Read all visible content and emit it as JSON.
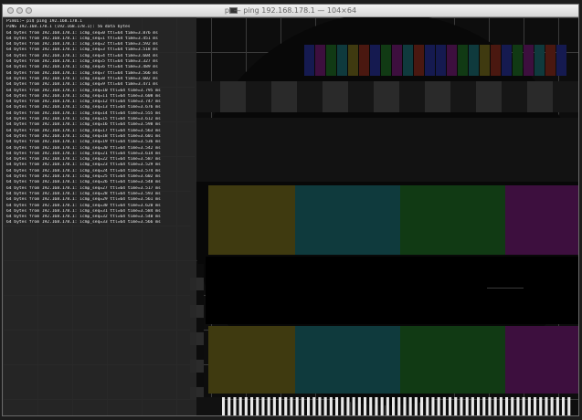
{
  "window": {
    "title": "pi — ping 192.168.178.1 — 104×64"
  },
  "terminal": {
    "lines": [
      "Pin01:~ pi$ ping 192.168.178.1",
      "PING 192.168.178.1 (192.168.178.1): 56 data bytes",
      "64 bytes from 192.168.178.1: icmp_seq=0 ttl=64 time=3.876 ms",
      "64 bytes from 192.168.178.1: icmp_seq=1 ttl=64 time=3.451 ms",
      "64 bytes from 192.168.178.1: icmp_seq=2 ttl=64 time=3.592 ms",
      "64 bytes from 192.168.178.1: icmp_seq=3 ttl=64 time=3.518 ms",
      "64 bytes from 192.168.178.1: icmp_seq=4 ttl=64 time=3.604 ms",
      "64 bytes from 192.168.178.1: icmp_seq=5 ttl=64 time=3.327 ms",
      "64 bytes from 192.168.178.1: icmp_seq=6 ttl=64 time=3.489 ms",
      "64 bytes from 192.168.178.1: icmp_seq=7 ttl=64 time=3.566 ms",
      "64 bytes from 192.168.178.1: icmp_seq=8 ttl=64 time=3.602 ms",
      "64 bytes from 192.168.178.1: icmp_seq=9 ttl=64 time=3.471 ms",
      "64 bytes from 192.168.178.1: icmp_seq=10 ttl=64 time=3.795 ms",
      "64 bytes from 192.168.178.1: icmp_seq=11 ttl=64 time=3.608 ms",
      "64 bytes from 192.168.178.1: icmp_seq=12 ttl=64 time=3.747 ms",
      "64 bytes from 192.168.178.1: icmp_seq=13 ttl=64 time=3.676 ms",
      "64 bytes from 192.168.178.1: icmp_seq=14 ttl=64 time=3.555 ms",
      "64 bytes from 192.168.178.1: icmp_seq=15 ttl=64 time=3.612 ms",
      "64 bytes from 192.168.178.1: icmp_seq=16 ttl=64 time=3.598 ms",
      "64 bytes from 192.168.178.1: icmp_seq=17 ttl=64 time=3.563 ms",
      "64 bytes from 192.168.178.1: icmp_seq=18 ttl=64 time=3.601 ms",
      "64 bytes from 192.168.178.1: icmp_seq=19 ttl=64 time=3.536 ms",
      "64 bytes from 192.168.178.1: icmp_seq=20 ttl=64 time=3.542 ms",
      "64 bytes from 192.168.178.1: icmp_seq=21 ttl=64 time=3.614 ms",
      "64 bytes from 192.168.178.1: icmp_seq=22 ttl=64 time=3.587 ms",
      "64 bytes from 192.168.178.1: icmp_seq=23 ttl=64 time=3.529 ms",
      "64 bytes from 192.168.178.1: icmp_seq=24 ttl=64 time=3.574 ms",
      "64 bytes from 192.168.178.1: icmp_seq=25 ttl=64 time=3.602 ms",
      "64 bytes from 192.168.178.1: icmp_seq=26 ttl=64 time=3.548 ms",
      "64 bytes from 192.168.178.1: icmp_seq=27 ttl=64 time=3.517 ms",
      "64 bytes from 192.168.178.1: icmp_seq=28 ttl=64 time=3.593 ms",
      "64 bytes from 192.168.178.1: icmp_seq=29 ttl=64 time=3.561 ms",
      "64 bytes from 192.168.178.1: icmp_seq=30 ttl=64 time=3.620 ms",
      "64 bytes from 192.168.178.1: icmp_seq=31 ttl=64 time=3.584 ms",
      "64 bytes from 192.168.178.1: icmp_seq=32 ttl=64 time=3.540 ms",
      "64 bytes from 192.168.178.1: icmp_seq=33 ttl=64 time=3.566 ms"
    ]
  },
  "wallpaper": {
    "icon": "tv-test-pattern",
    "colors": {
      "background": "#0d0d0d",
      "grid": "#3a3a3a",
      "grid_light": "#4a4a4a",
      "yellow": "#3f3a10",
      "cyan": "#0f3a3d",
      "green": "#113a14",
      "magenta": "#3d0f3e",
      "red": "#4a1810",
      "blue": "#151a50",
      "white": "#e8e8e8",
      "black": "#000000"
    }
  }
}
